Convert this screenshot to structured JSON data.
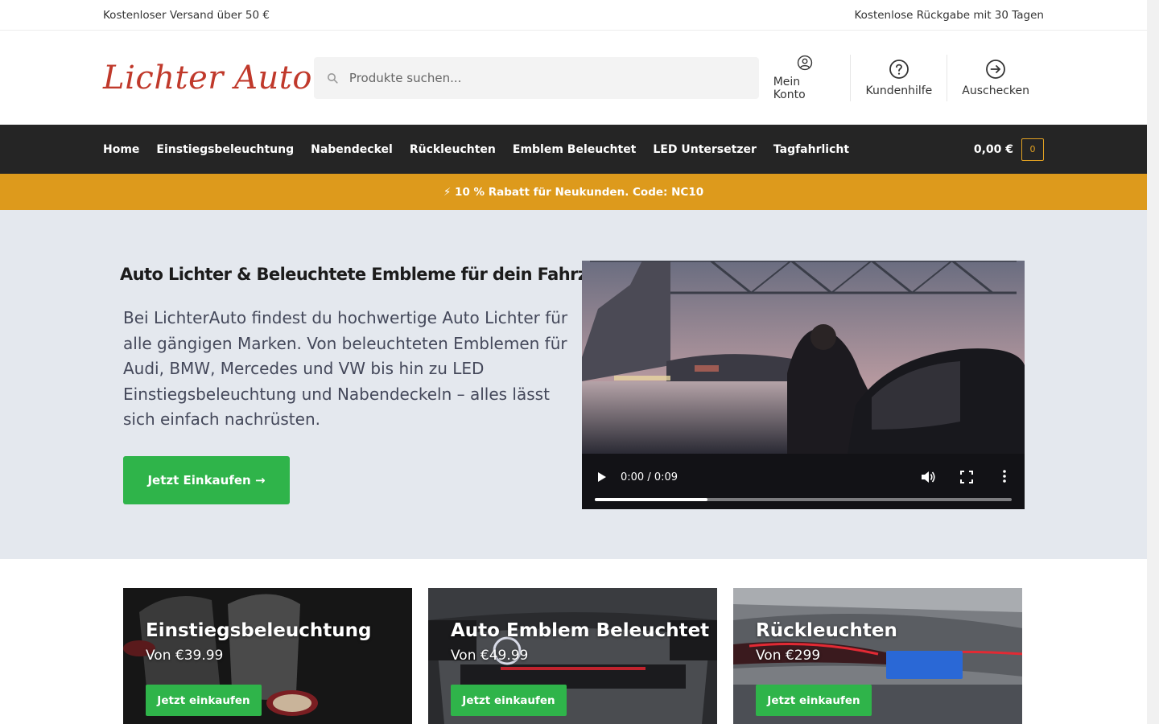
{
  "topbar": {
    "left": "Kostenloser Versand über 50 €",
    "right": "Kostenlose Rückgabe mit 30 Tagen"
  },
  "header": {
    "logo": "Lichter Auto",
    "search_placeholder": "Produkte suchen...",
    "links": [
      {
        "label": "Mein Konto",
        "icon": "user-circle-icon"
      },
      {
        "label": "Kundenhilfe",
        "icon": "help-circle-icon"
      },
      {
        "label": "Auschecken",
        "icon": "arrow-right-circle-icon"
      }
    ]
  },
  "nav": {
    "items": [
      "Home",
      "Einstiegsbeleuchtung",
      "Nabendeckel",
      "Rückleuchten",
      "Emblem Beleuchtet",
      "LED Untersetzer",
      "Tagfahrlicht"
    ],
    "cart_total": "0,00 €",
    "cart_count": "0"
  },
  "promo": {
    "text": "⚡ 10 % Rabatt für Neukunden. Code: NC10"
  },
  "hero": {
    "title": "Auto Lichter & Beleuchtete Embleme für dein Fahrzeug",
    "text": "Bei LichterAuto findest du hochwertige Auto Lichter für alle gängigen Marken. Von beleuchteten Emblemen für Audi, BMW, Mercedes und VW bis hin zu LED Einstiegsbeleuchtung und Nabendeckeln – alles lässt sich einfach nachrüsten.",
    "button": "Jetzt Einkaufen →",
    "video": {
      "time": "0:00 / 0:09",
      "progress": 0.27
    }
  },
  "categories": [
    {
      "title": "Einstiegsbeleuchtung",
      "price": "Von €39.99",
      "button": "Jetzt einkaufen"
    },
    {
      "title": "Auto Emblem Beleuchtet",
      "price": "Von €49.99",
      "button": "Jetzt einkaufen"
    },
    {
      "title": "Rückleuchten",
      "price": "Von €299",
      "button": "Jetzt einkaufen"
    }
  ],
  "colors": {
    "accent_green": "#2fb44a",
    "promo_orange": "#dd9a1c",
    "nav_dark": "#252525",
    "logo_red": "#c0392b",
    "hero_bg": "#e4e8ee"
  }
}
